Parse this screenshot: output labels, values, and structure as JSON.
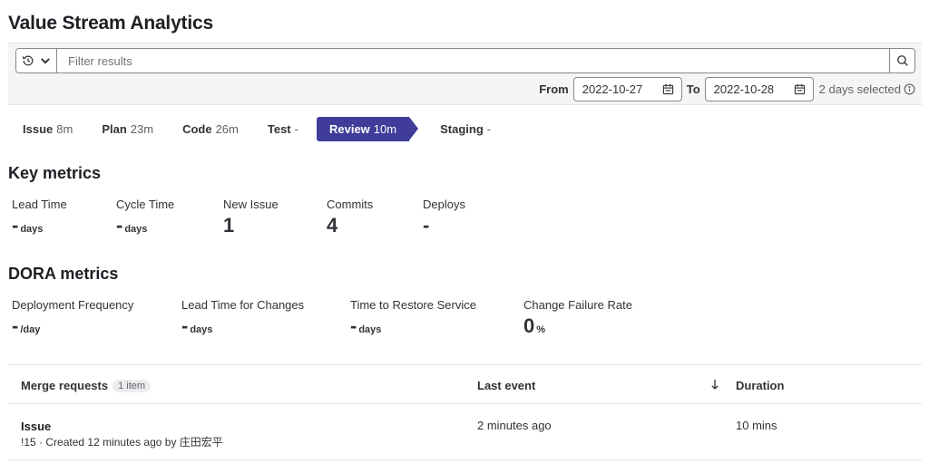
{
  "page": {
    "title": "Value Stream Analytics"
  },
  "filter": {
    "placeholder": "Filter results",
    "history_icon": "history-icon",
    "search_icon": "search-icon"
  },
  "date_range": {
    "from_label": "From",
    "from_value": "2022-10-27",
    "to_label": "To",
    "to_value": "2022-10-28",
    "days_selected": "2 days selected"
  },
  "stages": [
    {
      "name": "Issue",
      "time": "8m"
    },
    {
      "name": "Plan",
      "time": "23m"
    },
    {
      "name": "Code",
      "time": "26m"
    },
    {
      "name": "Test",
      "time": "-"
    },
    {
      "name": "Review",
      "time": "10m",
      "active": true
    },
    {
      "name": "Staging",
      "time": "-"
    }
  ],
  "key_metrics": {
    "title": "Key metrics",
    "items": [
      {
        "label": "Lead Time",
        "value": "-",
        "unit": "days"
      },
      {
        "label": "Cycle Time",
        "value": "-",
        "unit": "days"
      },
      {
        "label": "New Issue",
        "value": "1",
        "unit": ""
      },
      {
        "label": "Commits",
        "value": "4",
        "unit": ""
      },
      {
        "label": "Deploys",
        "value": "-",
        "unit": ""
      }
    ]
  },
  "dora_metrics": {
    "title": "DORA metrics",
    "items": [
      {
        "label": "Deployment Frequency",
        "value": "-",
        "unit": "/day"
      },
      {
        "label": "Lead Time for Changes",
        "value": "-",
        "unit": "days"
      },
      {
        "label": "Time to Restore Service",
        "value": "-",
        "unit": "days"
      },
      {
        "label": "Change Failure Rate",
        "value": "0",
        "unit": "%"
      }
    ]
  },
  "table": {
    "headers": {
      "merge_requests": "Merge requests",
      "count": "1 item",
      "last_event": "Last event",
      "duration": "Duration"
    },
    "rows": [
      {
        "title": "Issue",
        "ref": "!15",
        "created_prefix": " · Created ",
        "created_when": "12 minutes ago",
        "by": " by ",
        "author": "庄田宏平",
        "last_event": "2 minutes ago",
        "duration": "10 mins"
      }
    ]
  },
  "colors": {
    "accent": "#3f3d99",
    "text": "#333238",
    "muted": "#626168"
  }
}
